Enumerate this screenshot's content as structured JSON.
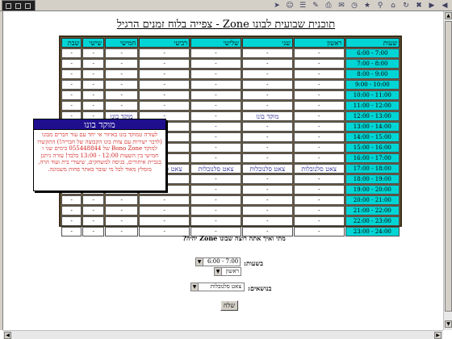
{
  "page_title": "תוכנית שבועית לבונו Zone - צפייה בלוח זמנים הרגיל",
  "toolbar_icons": [
    "back-icon",
    "forward-icon",
    "stop-icon",
    "refresh-icon",
    "home-icon",
    "search-icon",
    "favorites-icon",
    "history-icon",
    "mail-icon",
    "print-icon",
    "edit-icon",
    "discuss-icon",
    "messenger-icon",
    "nav-arrow-icon"
  ],
  "columns": [
    "שעות",
    "ראשון",
    "שני",
    "שלישי",
    "רביעי",
    "חמישי",
    "שישי",
    "שבת"
  ],
  "rows": [
    {
      "time": "6:00 - 7:00",
      "cells": [
        "-",
        "-",
        "-",
        "-",
        "-",
        "-",
        "-"
      ]
    },
    {
      "time": "7:00 - 8:00",
      "cells": [
        "-",
        "-",
        "-",
        "-",
        "-",
        "-",
        "-"
      ]
    },
    {
      "time": "8:00 - 9:00",
      "cells": [
        "-",
        "-",
        "-",
        "-",
        "-",
        "-",
        "-"
      ]
    },
    {
      "time": "9:00 - 10:00",
      "cells": [
        "-",
        "-",
        "-",
        "-",
        "-",
        "-",
        "-"
      ]
    },
    {
      "time": "10:00 - 11:00",
      "cells": [
        "-",
        "-",
        "-",
        "-",
        "-",
        "-",
        "-"
      ]
    },
    {
      "time": "11:00 - 12:00",
      "cells": [
        "-",
        "-",
        "-",
        "-",
        "-",
        "-",
        "-"
      ]
    },
    {
      "time": "12:00 - 13:00",
      "cells": [
        "-",
        "מוקד בונו",
        "-",
        "-",
        "מוקד בונו",
        "-",
        "-"
      ]
    },
    {
      "time": "13:00 - 14:00",
      "cells": [
        "-",
        "-",
        "-",
        "-",
        "-",
        "-",
        "-"
      ]
    },
    {
      "time": "14:00 - 15:00",
      "cells": [
        "-",
        "-",
        "-",
        "-",
        "-",
        "-",
        "-"
      ]
    },
    {
      "time": "15:00 - 16:00",
      "cells": [
        "-",
        "-",
        "-",
        "-",
        "-",
        "-",
        "-"
      ]
    },
    {
      "time": "16:00 - 17:00",
      "cells": [
        "-",
        "-",
        "-",
        "-",
        "-",
        "-",
        "-"
      ]
    },
    {
      "time": "17:00 - 18:00",
      "cells": [
        "צאט סלנובלות",
        "צאט סלנובלות",
        "צאט סלנובלות",
        "צאט סלנובלות",
        "צאט סל",
        "-",
        "-"
      ]
    },
    {
      "time": "18:00 - 19:00",
      "cells": [
        "-",
        "-",
        "-",
        "-",
        "-",
        "-",
        "-"
      ]
    },
    {
      "time": "19:00 - 20:00",
      "cells": [
        "-",
        "-",
        "-",
        "-",
        "-",
        "-",
        "-"
      ]
    },
    {
      "time": "20:00 - 21:00",
      "cells": [
        "-",
        "-",
        "-",
        "-",
        "-",
        "-",
        "-"
      ]
    },
    {
      "time": "21:00 - 22:00",
      "cells": [
        "-",
        "-",
        "-",
        "-",
        "-",
        "-",
        "-"
      ]
    },
    {
      "time": "22:00 - 23:00",
      "cells": [
        "-",
        "-",
        "-",
        "-",
        "-",
        "-",
        "-"
      ]
    },
    {
      "time": "23:00 - 24:00",
      "cells": [
        "-",
        "-",
        "-",
        "-",
        "-",
        "-",
        "-"
      ]
    }
  ],
  "popup": {
    "title": "מוקד בונו",
    "body": "לעזרה טמוקד בונו באיזור אי יחד עם עוד חברים מבונו (לדבר ישירות עם צוות בונו הקבוצה של חבריה!) התקשרו למוקד Bono Zone של 055448844 בימים שני ו חמישי בין השעות 12:00 - 13:00 בלבד! עזרה ניתנן בגביית איתורים, כגיסה למשחקים, שיעורי בית ועוד הרה, מומלץ מאוד לכל מי שזבר באתר פחות משמונה."
  },
  "form": {
    "question": "מתי ואיך אתה רוצה שבונו Zone יהיה?",
    "hours_label": "בשעות:",
    "hours_value": "6:00 - 7:00",
    "days_value": "ראשון",
    "topics_label": "בנושאים:",
    "topics_value": "צאט סלנובלות",
    "send_label": "שלח"
  },
  "colors": {
    "header_cyan": "#00d5d5",
    "popup_header": "#1f0f8f",
    "popup_text": "#d22020",
    "table_frame": "#6b5a3a"
  }
}
